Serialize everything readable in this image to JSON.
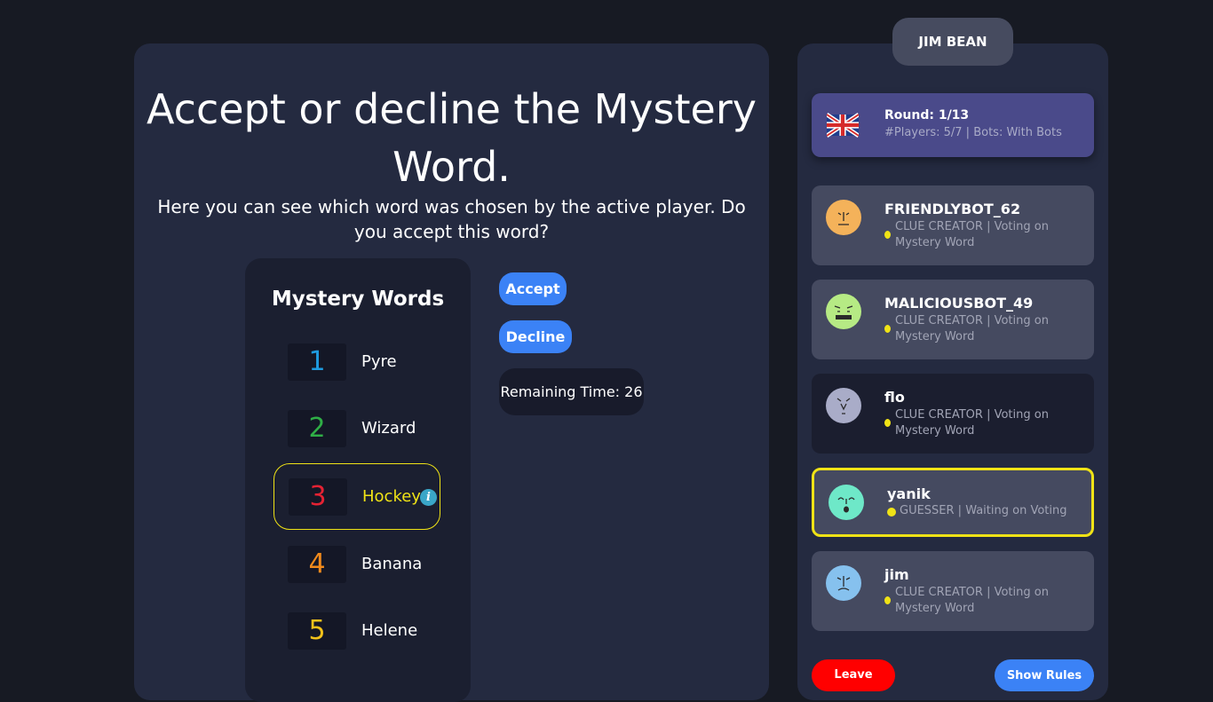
{
  "main": {
    "title": "Accept or decline the Mystery Word.",
    "subtitle": "Here you can see which word was chosen by the active player. Do you accept this word?",
    "words_title": "Mystery Words",
    "words": [
      {
        "num": "1",
        "label": "Pyre",
        "color": "#1e9be0"
      },
      {
        "num": "2",
        "label": "Wizard",
        "color": "#2fae46"
      },
      {
        "num": "3",
        "label": "Hockey",
        "color": "#e52233",
        "selected": true
      },
      {
        "num": "4",
        "label": "Banana",
        "color": "#f08a1c"
      },
      {
        "num": "5",
        "label": "Helene",
        "color": "#f3c21a"
      }
    ],
    "info_glyph": "i",
    "accept_label": "Accept",
    "decline_label": "Decline",
    "timer_text": "Remaining Time: 26"
  },
  "sidebar": {
    "user_name": "JIM BEAN",
    "round_label": "Round: 1/13",
    "round_meta": "#Players: 5/7 | Bots: With Bots",
    "flag_icon": "uk-flag-icon",
    "players": [
      {
        "name": "FRIENDLYBOT_62",
        "status": "CLUE CREATOR | Voting on Mystery Word",
        "avatar_color": "#f4b25a"
      },
      {
        "name": "MALICIOUSBOT_49",
        "status": "CLUE CREATOR | Voting on Mystery Word",
        "avatar_color": "#b6ea84"
      },
      {
        "name": "flo",
        "status": "CLUE CREATOR | Voting on Mystery Word",
        "avatar_color": "#a9acc8"
      },
      {
        "name": "yanik",
        "status": "GUESSER | Waiting on Voting",
        "avatar_color": "#6ee8c8"
      },
      {
        "name": "jim",
        "status": "CLUE CREATOR | Voting on Mystery Word",
        "avatar_color": "#86c1ee"
      }
    ],
    "leave_label": "Leave",
    "rules_label": "Show Rules"
  },
  "colors": {
    "accent": "#3b82f6",
    "highlight": "#f0e316",
    "leave": "#ff0000"
  }
}
